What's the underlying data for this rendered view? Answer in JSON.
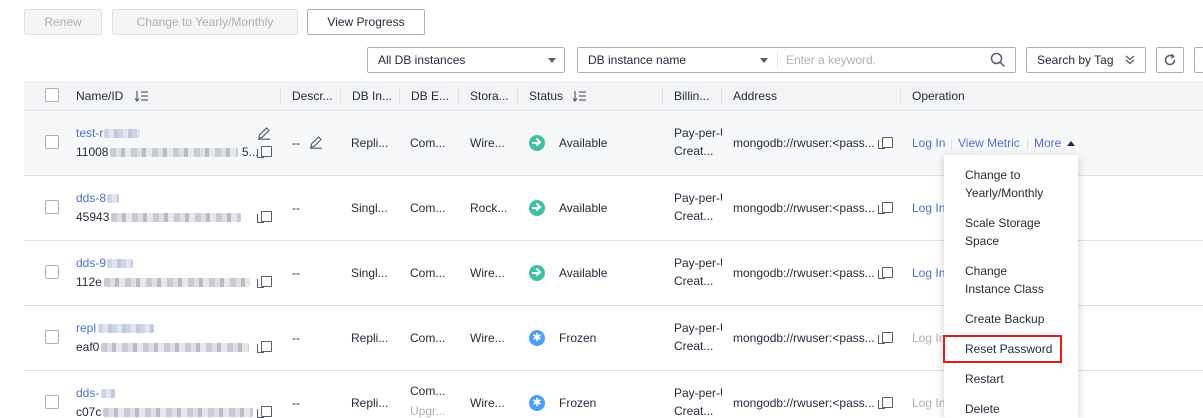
{
  "toolbar": {
    "renew": "Renew",
    "change_to_yearly": "Change to Yearly/Monthly",
    "view_progress": "View Progress"
  },
  "filters": {
    "instance_filter": "All DB instances",
    "search_field": "DB instance name",
    "search_placeholder": "Enter a keyword.",
    "search_by_tag": "Search by Tag"
  },
  "table": {
    "headers": [
      "Name/ID",
      "Descr...",
      "DB In...",
      "DB E...",
      "Stora...",
      "Status",
      "Billin...",
      "Address",
      "Operation"
    ],
    "rows": [
      {
        "name": "test-r",
        "id": "11008",
        "id_tail": "5...",
        "desc": "--",
        "db_instance": "Repli...",
        "db_engine": "Com...",
        "storage": "Wire...",
        "status": "Available",
        "status_kind": "ok",
        "billing1": "Pay-per-U",
        "billing2": "Creat...",
        "address": "mongodb://rwuser:<pass...",
        "op_login": "Log In",
        "op_metric": "View Metric",
        "op_more": "More"
      },
      {
        "name": "dds-8",
        "id": "45943",
        "desc": "--",
        "db_instance": "Singl...",
        "db_engine": "Com...",
        "storage": "Rock...",
        "status": "Available",
        "status_kind": "ok",
        "billing1": "Pay-per-U",
        "billing2": "Creat...",
        "address": "mongodb://rwuser:<pass...",
        "op_login": "Log In"
      },
      {
        "name": "dds-9",
        "id": "112e",
        "desc": "--",
        "db_instance": "Singl...",
        "db_engine": "Com...",
        "storage": "Wire...",
        "status": "Available",
        "status_kind": "ok",
        "billing1": "Pay-per-U",
        "billing2": "Creat...",
        "address": "mongodb://rwuser:<pass...",
        "op_login": "Log In"
      },
      {
        "name": "repl",
        "id": "eaf0",
        "desc": "--",
        "db_instance": "Repli...",
        "db_engine": "Com...",
        "storage": "Wire...",
        "status": "Frozen",
        "status_kind": "frozen",
        "billing1": "Pay-per-U",
        "billing2": "Creat...",
        "address": "mongodb://rwuser:<pass...",
        "op_login": "Log In"
      },
      {
        "name": "dds-",
        "id": "c07c",
        "desc": "--",
        "db_instance": "Repli...",
        "db_engine": "Com...",
        "db_engine2": "Upgr...",
        "storage": "Wire...",
        "status": "Frozen",
        "status_kind": "frozen",
        "billing1": "Pay-per-U",
        "billing2": "Creat...",
        "address": "mongodb://rwuser:<pass...",
        "op_login": "Log In"
      }
    ]
  },
  "more_menu": {
    "items": [
      "Change to Yearly/Monthly",
      "Scale Storage Space",
      "Change Instance Class",
      "Create Backup",
      "Reset Password",
      "Restart",
      "Delete"
    ],
    "highlighted": "Reset Password"
  },
  "colors": {
    "link": "#526ecc",
    "available": "#3ec1a1",
    "frozen": "#4d9ef5",
    "highlight_border": "#e31b1b"
  }
}
